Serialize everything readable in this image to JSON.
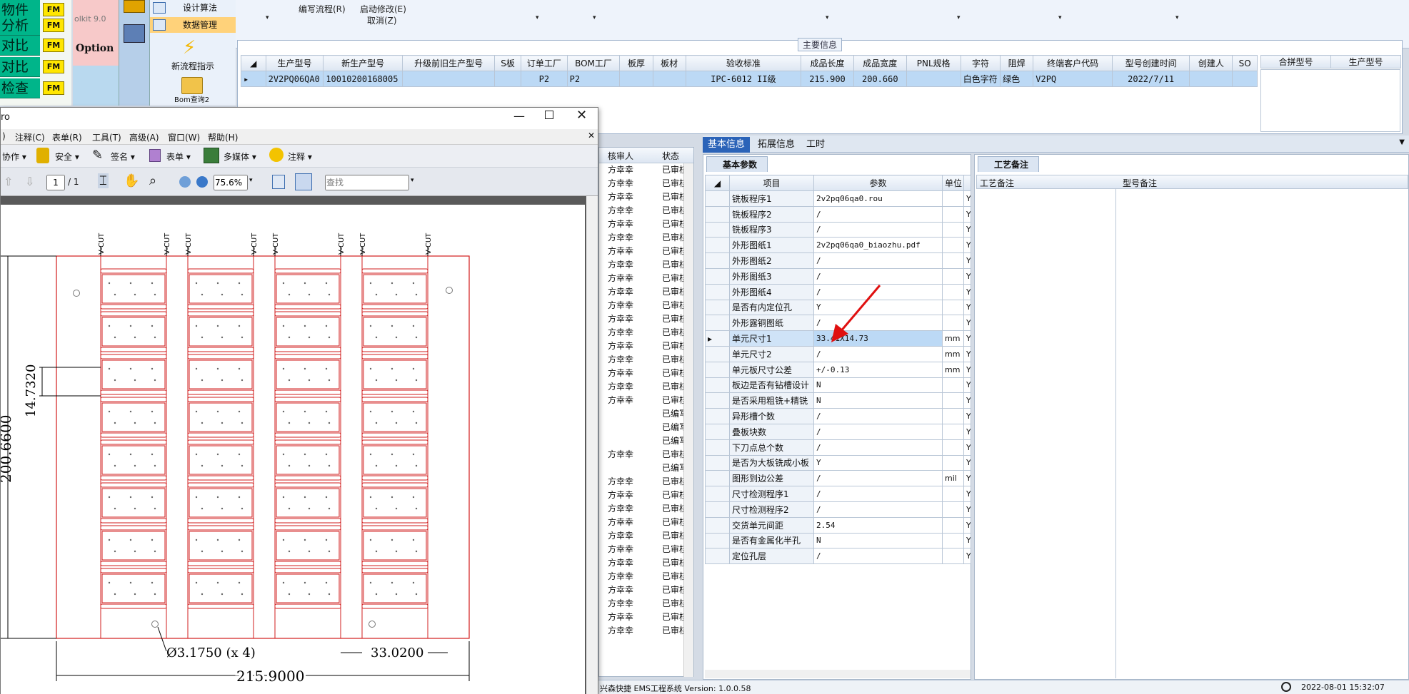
{
  "left_panel": {
    "rows": [
      {
        "label": "物件",
        "btn": "FM"
      },
      {
        "label": "分析",
        "btn": "FM"
      },
      {
        "label": "对比",
        "btn": "FM"
      },
      {
        "label": "对比",
        "btn": "FM"
      },
      {
        "label": "检查",
        "btn": "FM"
      }
    ],
    "toolkit_text": "olkit 9.0",
    "option_text": "Option"
  },
  "ribbon": {
    "items": [
      "设计算法",
      "数据管理",
      "新流程指示",
      "Bom查询2"
    ]
  },
  "top_menu": {
    "items": [
      "编写流程(R)",
      "启动修改(E)",
      "取消(Z)"
    ]
  },
  "main_info": {
    "title": "主要信息",
    "headers": [
      "生产型号",
      "新生产型号",
      "升级前旧生产型号",
      "S板",
      "订单工厂",
      "BOM工厂",
      "板厚",
      "板材",
      "验收标准",
      "成品长度",
      "成品宽度",
      "PNL规格",
      "字符",
      "阻焊",
      "终端客户代码",
      "型号创建时间",
      "创建人",
      "SO"
    ],
    "row": [
      "2V2PQ06QA0",
      "10010200168005",
      "",
      "",
      "P2",
      "P2",
      "",
      "",
      "IPC-6012 II级",
      "215.900",
      "200.660",
      "",
      "白色字符",
      "绿色",
      "V2PQ",
      "2022/7/11",
      "",
      ""
    ],
    "right_headers": [
      "合拼型号",
      "生产型号"
    ]
  },
  "pdf_viewer": {
    "title_fragment": "ro",
    "menu": [
      "注释(C)",
      "表单(R)",
      "工具(T)",
      "高级(A)",
      "窗口(W)",
      "帮助(H)"
    ],
    "toolbar1": [
      "协作",
      "安全",
      "签名",
      "表单",
      "多媒体",
      "注释"
    ],
    "page_current": "1",
    "page_total": "/ 1",
    "zoom": "75.6%",
    "search_placeholder": "查找",
    "vcut_label": "V-CUT",
    "dims": {
      "pitch": "14.7320",
      "height": "200.6600",
      "hole": "Ø3.1750 (x 4)",
      "col_width": "33.0200",
      "total_width": "215.9000"
    }
  },
  "reviewers": {
    "headers": [
      "核审人",
      "状态"
    ],
    "rows": [
      {
        "name": "方幸幸",
        "status": "已审核"
      },
      {
        "name": "方幸幸",
        "status": "已审核"
      },
      {
        "name": "方幸幸",
        "status": "已审核"
      },
      {
        "name": "方幸幸",
        "status": "已审核"
      },
      {
        "name": "方幸幸",
        "status": "已审核"
      },
      {
        "name": "方幸幸",
        "status": "已审核"
      },
      {
        "name": "方幸幸",
        "status": "已审核"
      },
      {
        "name": "方幸幸",
        "status": "已审核"
      },
      {
        "name": "方幸幸",
        "status": "已审核"
      },
      {
        "name": "方幸幸",
        "status": "已审核"
      },
      {
        "name": "方幸幸",
        "status": "已审核"
      },
      {
        "name": "方幸幸",
        "status": "已审核"
      },
      {
        "name": "方幸幸",
        "status": "已审核"
      },
      {
        "name": "方幸幸",
        "status": "已审核"
      },
      {
        "name": "方幸幸",
        "status": "已审核"
      },
      {
        "name": "方幸幸",
        "status": "已审核"
      },
      {
        "name": "方幸幸",
        "status": "已审核"
      },
      {
        "name": "方幸幸",
        "status": "已审核"
      },
      {
        "name": "",
        "status": "已编写"
      },
      {
        "name": "",
        "status": "已编写"
      },
      {
        "name": "",
        "status": "已编写"
      },
      {
        "name": "方幸幸",
        "status": "已审核"
      },
      {
        "name": "",
        "status": "已编写"
      },
      {
        "name": "方幸幸",
        "status": "已审核"
      },
      {
        "name": "方幸幸",
        "status": "已审核"
      },
      {
        "name": "方幸幸",
        "status": "已审核"
      },
      {
        "name": "方幸幸",
        "status": "已审核"
      },
      {
        "name": "方幸幸",
        "status": "已审核"
      },
      {
        "name": "方幸幸",
        "status": "已审核"
      },
      {
        "name": "方幸幸",
        "status": "已审核"
      },
      {
        "name": "方幸幸",
        "status": "已审核"
      },
      {
        "name": "方幸幸",
        "status": "已审核"
      },
      {
        "name": "方幸幸",
        "status": "已审核"
      },
      {
        "name": "方幸幸",
        "status": "已审核"
      },
      {
        "name": "方幸幸",
        "status": "已审核"
      }
    ]
  },
  "tabs": [
    "基本信息",
    "拓展信息",
    "工时"
  ],
  "basic_params": {
    "section": "基本参数",
    "headers": [
      "项目",
      "参数",
      "单位"
    ],
    "rows": [
      {
        "item": "铣板程序1",
        "param": "2v2pq06qa0.rou",
        "unit": "",
        "flag": "Y"
      },
      {
        "item": "铣板程序2",
        "param": "/",
        "unit": "",
        "flag": "Y"
      },
      {
        "item": "铣板程序3",
        "param": "/",
        "unit": "",
        "flag": "Y"
      },
      {
        "item": "外形图纸1",
        "param": "2v2pq06qa0_biaozhu.pdf",
        "unit": "",
        "flag": "Y"
      },
      {
        "item": "外形图纸2",
        "param": "/",
        "unit": "",
        "flag": "Y"
      },
      {
        "item": "外形图纸3",
        "param": "/",
        "unit": "",
        "flag": "Y"
      },
      {
        "item": "外形图纸4",
        "param": "/",
        "unit": "",
        "flag": "Y"
      },
      {
        "item": "是否有内定位孔",
        "param": "Y",
        "unit": "",
        "flag": "Y"
      },
      {
        "item": "外形露铜图纸",
        "param": "/",
        "unit": "",
        "flag": "Y"
      },
      {
        "item": "单元尺寸1",
        "param": "33.41X14.73",
        "unit": "mm",
        "flag": "Y"
      },
      {
        "item": "单元尺寸2",
        "param": "/",
        "unit": "mm",
        "flag": "Y"
      },
      {
        "item": "单元板尺寸公差",
        "param": "+/-0.13",
        "unit": "mm",
        "flag": "Y"
      },
      {
        "item": "板边是否有钻槽设计",
        "param": "N",
        "unit": "",
        "flag": "Y"
      },
      {
        "item": "是否采用粗铣+精铣",
        "param": "N",
        "unit": "",
        "flag": "Y"
      },
      {
        "item": "异形槽个数",
        "param": "/",
        "unit": "",
        "flag": "Y"
      },
      {
        "item": "叠板块数",
        "param": "/",
        "unit": "",
        "flag": "Y"
      },
      {
        "item": "下刀点总个数",
        "param": "/",
        "unit": "",
        "flag": "Y"
      },
      {
        "item": "是否为大板铣成小板",
        "param": "Y",
        "unit": "",
        "flag": "Y"
      },
      {
        "item": "图形到边公差",
        "param": "/",
        "unit": "mil",
        "flag": "Y"
      },
      {
        "item": "尺寸检测程序1",
        "param": "/",
        "unit": "",
        "flag": "Y"
      },
      {
        "item": "尺寸检测程序2",
        "param": "/",
        "unit": "",
        "flag": "Y"
      },
      {
        "item": "交货单元间距",
        "param": "2.54",
        "unit": "",
        "flag": "Y"
      },
      {
        "item": "是否有金属化半孔",
        "param": "N",
        "unit": "",
        "flag": "Y"
      },
      {
        "item": "定位孔层",
        "param": "/",
        "unit": "",
        "flag": "Y"
      }
    ]
  },
  "process_notes": {
    "section": "工艺备注",
    "headers": [
      "工艺备注",
      "型号备注"
    ]
  },
  "status_bar": {
    "app": "兴森快捷 EMS工程系统 Version: 1.0.0.58",
    "datetime": "2022-08-01 15:32:07"
  },
  "colors": {
    "accent": "#2b63b8",
    "selection": "#bcd9f5",
    "drawing_red": "#d11c1c"
  }
}
